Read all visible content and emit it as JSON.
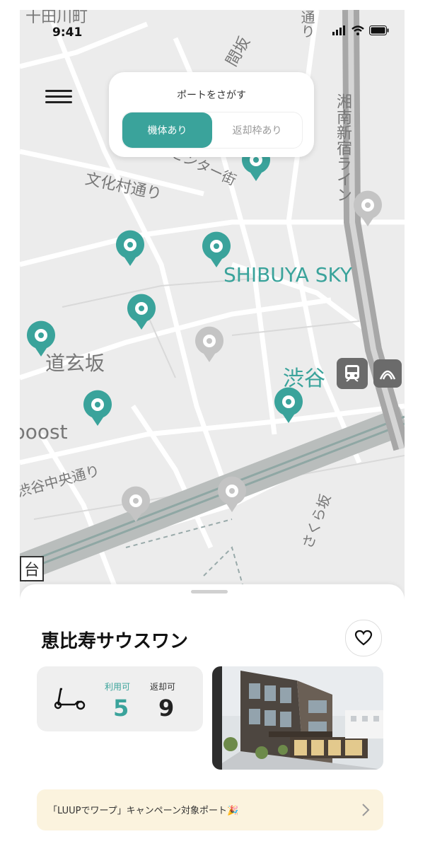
{
  "status_bar": {
    "time": "9:41"
  },
  "search_card": {
    "title": "ポートをさがす",
    "options": [
      "機体あり",
      "返却枠あり"
    ],
    "selected": "機体あり"
  },
  "map": {
    "labels": {
      "bunkamura_st": "文化村通り",
      "sky": "SHIBUYA SKY",
      "dogenzaka": "道玄坂",
      "shibuya": "渋谷",
      "boost": "boost",
      "chuo_st": "渋谷中央通り",
      "shonan": "湘南新宿ライン",
      "sakura": "さくら坂",
      "center": "センター街",
      "saka": "間坂",
      "dai": "台",
      "dori": "通り",
      "top": "十田川町"
    },
    "pins": [
      {
        "status": "available"
      },
      {
        "status": "available"
      },
      {
        "status": "available"
      },
      {
        "status": "available"
      },
      {
        "status": "available"
      },
      {
        "status": "available"
      },
      {
        "status": "available"
      },
      {
        "status": "unavailable"
      },
      {
        "status": "unavailable"
      },
      {
        "status": "unavailable"
      },
      {
        "status": "unavailable"
      }
    ]
  },
  "port": {
    "name": "恵比寿サウスワン",
    "available_label": "利用可",
    "available_count": "5",
    "return_label": "返却可",
    "return_count": "9"
  },
  "campaign": {
    "text": "「LUUPでワープ」キャンペーン対象ポート🎉"
  },
  "colors": {
    "accent": "#3aa39b",
    "pin_gray": "#c4c4c4",
    "banner": "#fbf3de"
  },
  "icons": [
    "hamburger-menu-icon",
    "heart-icon",
    "scooter-icon",
    "chevron-right-icon",
    "train-icon",
    "metro-icon",
    "signal-icon",
    "wifi-icon",
    "battery-icon"
  ]
}
